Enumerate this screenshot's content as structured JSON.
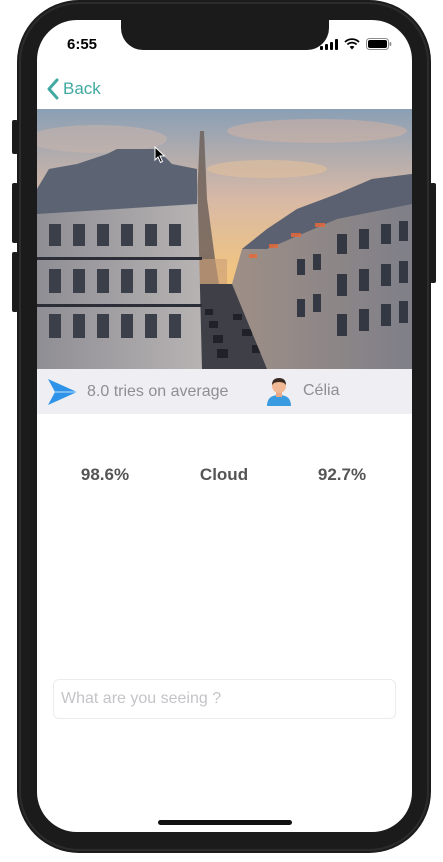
{
  "status": {
    "time": "6:55",
    "icons": [
      "cellular-icon",
      "wifi-icon",
      "battery-icon"
    ]
  },
  "nav": {
    "back_label": "Back"
  },
  "photo": {
    "subject": "Paris street with Eiffel Tower at sunset"
  },
  "info": {
    "tries_text": "8.0 tries on average",
    "user_name": "Célia"
  },
  "results": {
    "left_value": "98.6%",
    "center_label": "Cloud",
    "right_value": "92.7%"
  },
  "answer": {
    "placeholder": "What are you seeing ?",
    "value": ""
  },
  "colors": {
    "accent": "#41a9a1",
    "plane": "#2f93e9",
    "info_bar_bg": "#efeff3",
    "muted_text": "#8e8e93"
  }
}
